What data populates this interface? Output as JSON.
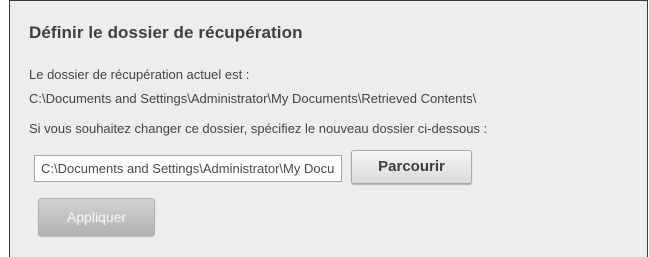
{
  "panel": {
    "title": "Définir le dossier de récupération",
    "current_label": "Le dossier de récupération actuel est :",
    "current_path": "C:\\Documents and Settings\\Administrator\\My Documents\\Retrieved Contents\\",
    "instruction": "Si vous souhaitez changer ce dossier, spécifiez le nouveau dossier ci-dessous :"
  },
  "folder_input": {
    "value": "C:\\Documents and Settings\\Administrator\\My Documents\\Retrieved Contents\\"
  },
  "buttons": {
    "browse_label": "Parcourir",
    "apply_label": "Appliquer",
    "apply_enabled": false
  },
  "colors": {
    "panel_background": "#ededed",
    "border": "#3a3a3a",
    "disabled_button": "#b3b3b3"
  }
}
